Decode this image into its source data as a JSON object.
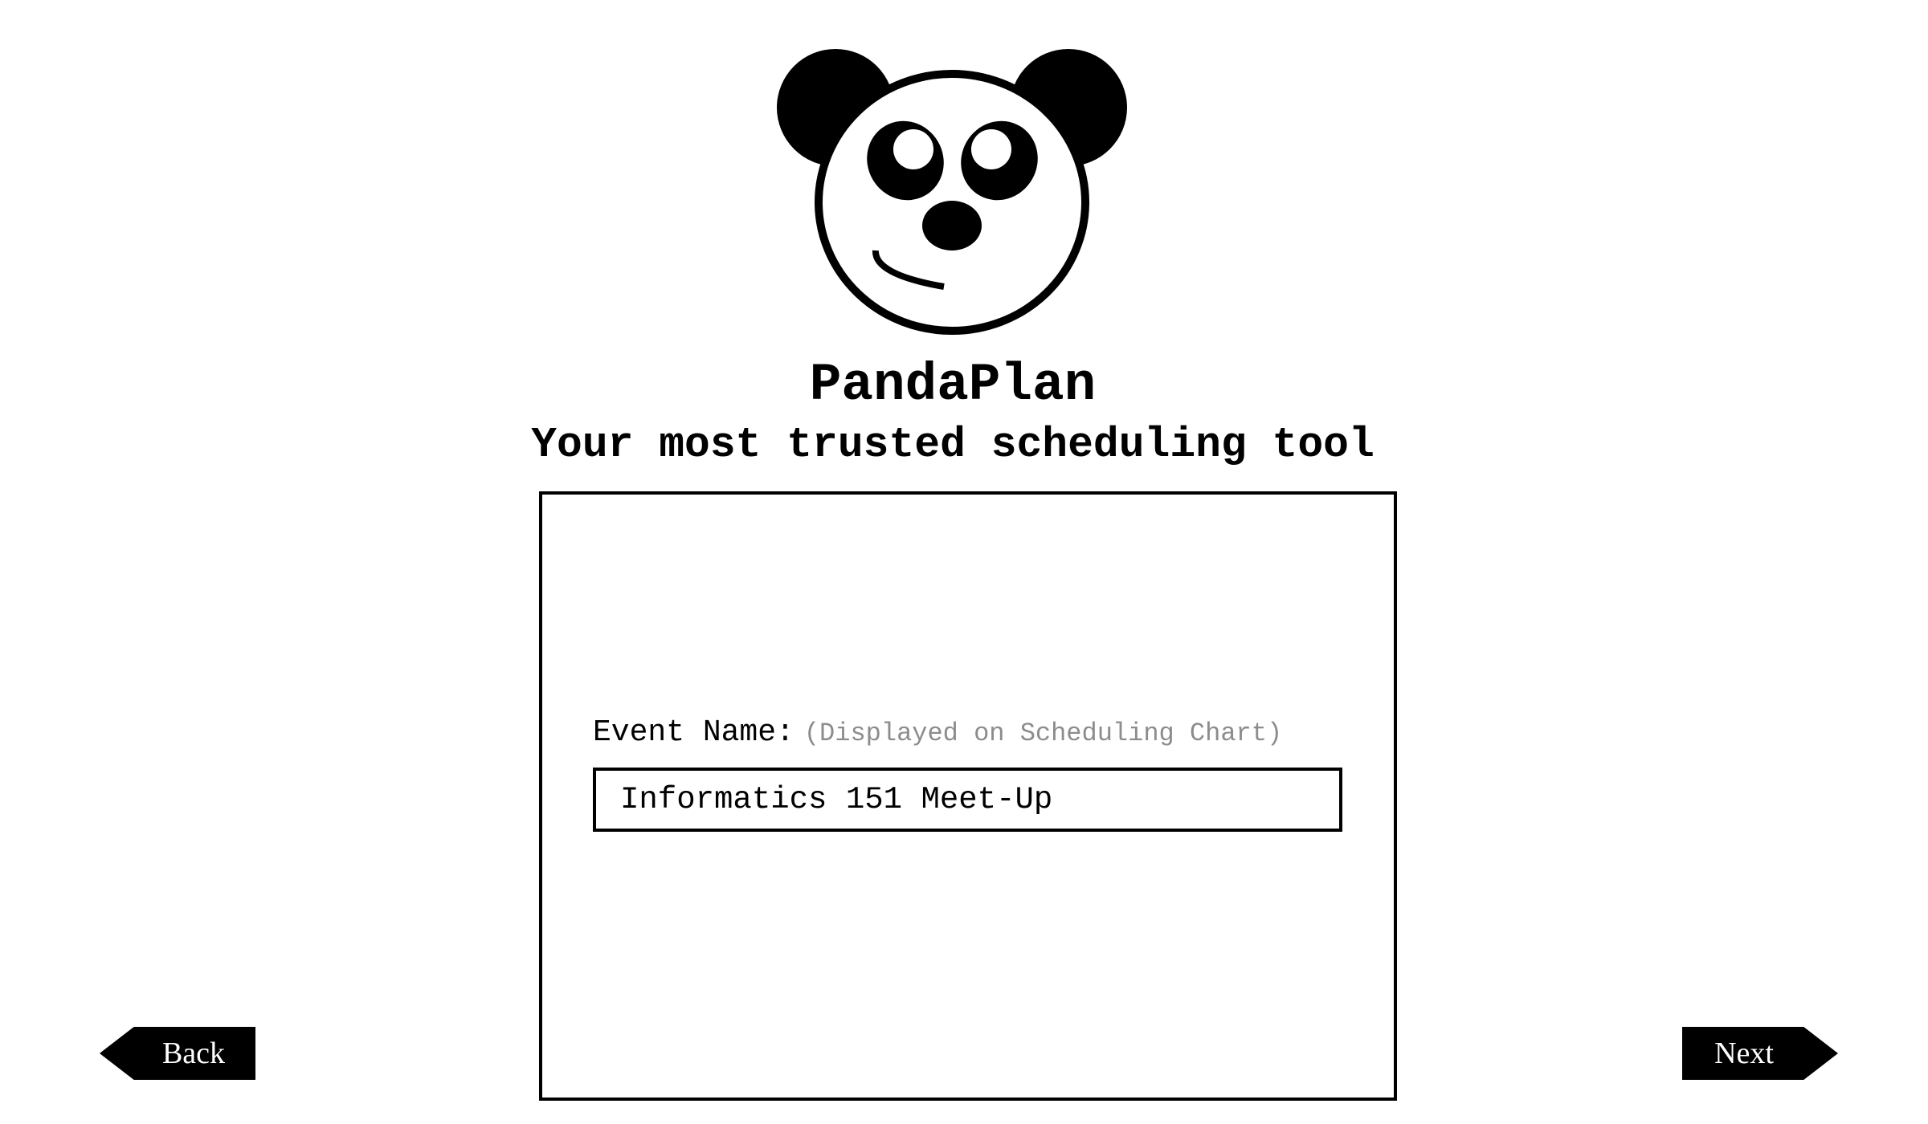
{
  "app": {
    "title": "PandaPlan",
    "tagline": "Your most trusted scheduling tool"
  },
  "logo": {
    "icon": "panda-face-icon"
  },
  "form": {
    "event_name_label": "Event Name:",
    "event_name_hint": "(Displayed on Scheduling Chart)",
    "event_name_value": "Informatics 151 Meet-Up"
  },
  "nav": {
    "back_label": "Back",
    "next_label": "Next"
  },
  "colors": {
    "primary": "#000000",
    "background": "#ffffff",
    "hint": "#8c8c8c"
  }
}
